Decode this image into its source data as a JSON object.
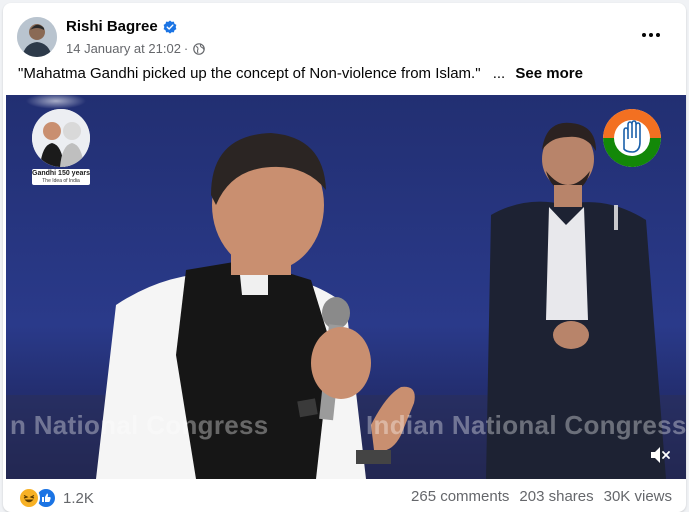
{
  "post": {
    "author": "Rishi Bagree",
    "timestamp": "14 January at 21:02",
    "separator": "·",
    "privacy_icon": "globe-icon",
    "verified_icon": "verified-badge-icon",
    "more_icon": "more-options-icon",
    "caption": "\"Mahatma Gandhi picked up the concept of Non-violence from Islam.\"",
    "caption_ellipsis": "...",
    "see_more": "See more"
  },
  "video": {
    "overlay_badge": {
      "line1": "Gandhi 150 years",
      "line2": "The Idea of India"
    },
    "watermark_left": "n National Congress",
    "watermark_right": "Indian National Congress",
    "mute_icon": "muted-speaker-icon"
  },
  "footer": {
    "reaction_icons": [
      "haha-icon",
      "like-icon"
    ],
    "reaction_count": "1.2K",
    "comments": "265 comments",
    "shares": "203 shares",
    "views": "30K views"
  },
  "colors": {
    "brand_blue": "#1b74e4",
    "text_primary": "#050505",
    "text_secondary": "#65676b",
    "video_background": "#26347a"
  }
}
